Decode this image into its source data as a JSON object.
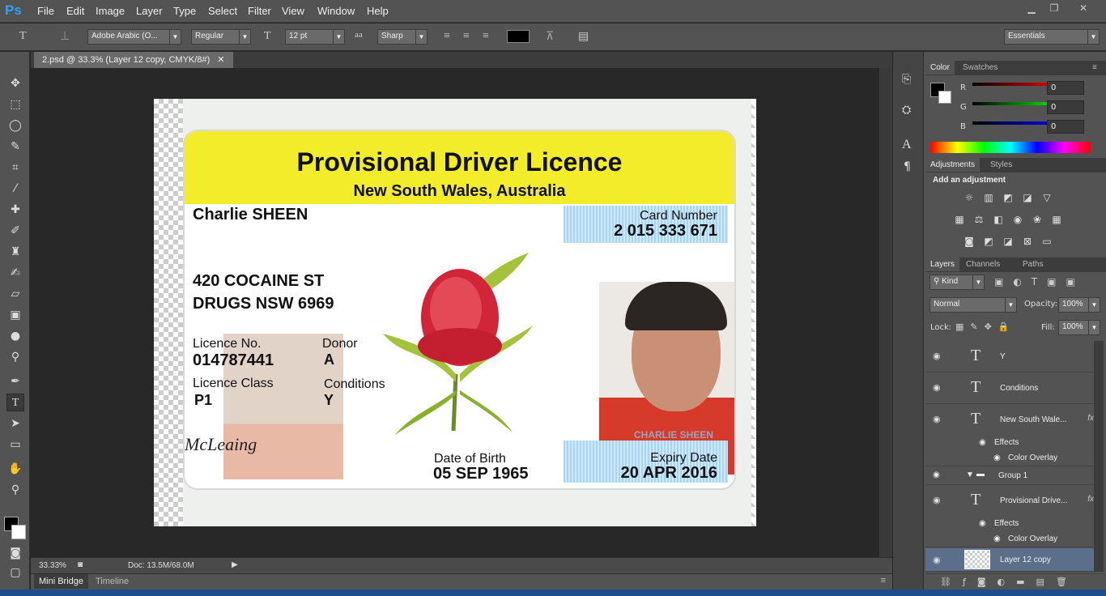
{
  "app": {
    "logo": "Ps"
  },
  "menu": [
    "File",
    "Edit",
    "Image",
    "Layer",
    "Type",
    "Select",
    "Filter",
    "View",
    "Window",
    "Help"
  ],
  "options": {
    "font_family": "Adobe Arabic (O...",
    "font_style": "Regular",
    "font_size": "12 pt",
    "antialias": "aa",
    "antialias_mode": "Sharp",
    "workspace": "Essentials",
    "text_color": "#000000"
  },
  "document": {
    "tab_title": "2.psd @ 33.3% (Layer 12 copy, CMYK/8#)",
    "zoom": "33.33%",
    "doc_size": "Doc: 13.5M/68.0M"
  },
  "bottom_tabs": {
    "mini_bridge": "Mini Bridge",
    "timeline": "Timeline"
  },
  "licence": {
    "title": "Provisional Driver Licence",
    "subtitle": "New South Wales, Australia",
    "name": "Charlie SHEEN",
    "card_number_label": "Card Number",
    "card_number": "2 015 333 671",
    "address1": "420 COCAINE ST",
    "address2": "DRUGS NSW 6969",
    "licence_no_label": "Licence No.",
    "licence_no": "014787441",
    "donor_label": "Donor",
    "donor": "A",
    "licence_class_label": "Licence Class",
    "licence_class": "P1",
    "conditions_label": "Conditions",
    "conditions": "Y",
    "dob_label": "Date of Birth",
    "dob": "05 SEP 1965",
    "expiry_label": "Expiry Date",
    "expiry": "20 APR 2016",
    "photo_caption": "CHARLIE SHEEN",
    "signature": "McLeaing"
  },
  "color_panel": {
    "tabs": [
      "Color",
      "Swatches"
    ],
    "r_label": "R",
    "g_label": "G",
    "b_label": "B",
    "r": "0",
    "g": "0",
    "b": "0"
  },
  "adjust_panel": {
    "tabs": [
      "Adjustments",
      "Styles"
    ],
    "heading": "Add an adjustment"
  },
  "layers_panel": {
    "tabs": [
      "Layers",
      "Channels",
      "Paths"
    ],
    "kind": "Kind",
    "blend_mode": "Normal",
    "opacity_label": "Opacity:",
    "opacity": "100%",
    "lock_label": "Lock:",
    "fill_label": "Fill:",
    "fill": "100%",
    "layers": [
      {
        "name": "Y"
      },
      {
        "name": "Conditions"
      },
      {
        "name": "New South Wale...",
        "fx": "fx"
      },
      {
        "effects": "Effects"
      },
      {
        "color_overlay": "Color Overlay"
      },
      {
        "name": "Group 1"
      },
      {
        "name": "Provisional Drive...",
        "fx": "fx"
      },
      {
        "effects": "Effects"
      },
      {
        "color_overlay": "Color Overlay"
      },
      {
        "name": "Layer 12 copy"
      }
    ]
  }
}
